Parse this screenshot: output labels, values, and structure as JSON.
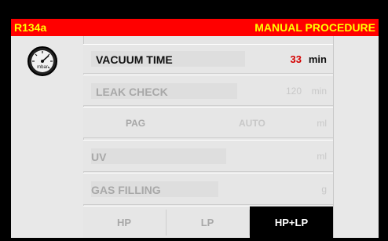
{
  "header": {
    "refrigerant": "R134a",
    "mode": "MANUAL PROCEDURE"
  },
  "gauge": {
    "unit": "mbar"
  },
  "rows": {
    "vacuum": {
      "label": "VACUUM TIME",
      "value": "33",
      "unit": "min"
    },
    "leak": {
      "label": "LEAK CHECK",
      "value": "120",
      "unit": "min"
    },
    "oil": {
      "label": "PAG",
      "value": "AUTO",
      "unit": "ml"
    },
    "uv": {
      "label": "UV",
      "value": "",
      "unit": "ml"
    },
    "gas": {
      "label": "GAS FILLING",
      "value": "",
      "unit": "g"
    }
  },
  "tabs": {
    "hp": "HP",
    "lp": "LP",
    "hplp": "HP+LP"
  },
  "colors": {
    "header_bg": "#ff0000",
    "header_text": "#ffff00",
    "value_active": "#d40000"
  }
}
